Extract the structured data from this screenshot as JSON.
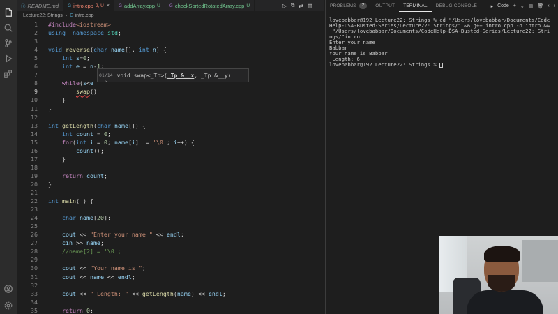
{
  "tabs": [
    {
      "icon": "ⓘ",
      "label": "README.md",
      "modifier": "",
      "style": "italic",
      "active": false
    },
    {
      "icon": "G",
      "label": "intro.cpp",
      "modifier": "2, U",
      "style": "active",
      "active": true
    },
    {
      "icon": "G",
      "label": "addArray.cpp",
      "modifier": "U",
      "style": "green",
      "active": false
    },
    {
      "icon": "G",
      "label": "checkSortedRotatedArray.cpp",
      "modifier": "U",
      "style": "green",
      "active": false
    }
  ],
  "breadcrumb": {
    "folder": "Lecture22: Strings",
    "file": "intro.cpp"
  },
  "hint": {
    "counter": "01/14",
    "pre": "void swap<_Tp>(",
    "param": "_Tp &__x",
    "post": ", _Tp &__y)"
  },
  "panel": {
    "tabs": [
      "PROBLEMS",
      "OUTPUT",
      "TERMINAL",
      "DEBUG CONSOLE"
    ],
    "problems_count": "2",
    "active_tab": "TERMINAL",
    "shell": "Code"
  },
  "terminal": [
    "lovebabbar@192 Lecture22: Strings % cd \"/Users/lovebabbar/Documents/Code",
    "Help-DSA-Busted-Series/Lecture22: Strings/\" && g++ intro.cpp -o intro &&",
    " \"/Users/lovebabbar/Documents/CodeHelp-DSA-Busted-Series/Lecture22: Stri",
    "ngs/\"intro",
    "Enter your name",
    "Babbar",
    "Your name is Babbar",
    " Length: 6",
    "lovebabbar@192 Lecture22: Strings % "
  ],
  "code": [
    {
      "n": "1",
      "t": [
        [
          "pp",
          "#include"
        ],
        [
          "inc",
          "<iostream>"
        ]
      ]
    },
    {
      "n": "2",
      "t": [
        [
          "kw",
          "using"
        ],
        [
          "",
          "  "
        ],
        [
          "kw",
          "namespace"
        ],
        [
          "",
          ""
        ],
        [
          "ns",
          " std"
        ],
        [
          "",
          ";"
        ]
      ]
    },
    {
      "n": "3",
      "t": []
    },
    {
      "n": "4",
      "t": [
        [
          "kw",
          "void"
        ],
        [
          "",
          " "
        ],
        [
          "fn",
          "reverse"
        ],
        [
          "",
          "("
        ],
        [
          "kw",
          "char"
        ],
        [
          "",
          " "
        ],
        [
          "var",
          "name"
        ],
        [
          "",
          "[], "
        ],
        [
          "kw",
          "int"
        ],
        [
          "",
          " "
        ],
        [
          "var",
          "n"
        ],
        [
          "",
          ") {"
        ]
      ]
    },
    {
      "n": "5",
      "t": [
        [
          "",
          "    "
        ],
        [
          "kw",
          "int"
        ],
        [
          "",
          " "
        ],
        [
          "var",
          "s"
        ],
        [
          "",
          "="
        ],
        [
          "num",
          "0"
        ],
        [
          "",
          ";"
        ]
      ]
    },
    {
      "n": "6",
      "t": [
        [
          "",
          "    "
        ],
        [
          "kw",
          "int"
        ],
        [
          "",
          " "
        ],
        [
          "var",
          "e"
        ],
        [
          "",
          " = "
        ],
        [
          "var",
          "n"
        ],
        [
          "",
          "-"
        ],
        [
          "num",
          "1"
        ],
        [
          "",
          ";"
        ]
      ]
    },
    {
      "n": "7",
      "t": []
    },
    {
      "n": "8",
      "t": [
        [
          "",
          "    "
        ],
        [
          "ctl",
          "while"
        ],
        [
          "",
          "("
        ],
        [
          "var",
          "s"
        ],
        [
          "",
          "<"
        ],
        [
          "var",
          "e"
        ],
        [
          "",
          ""
        ]
      ]
    },
    {
      "n": "9",
      "t": [
        [
          "",
          "        "
        ],
        [
          "fn squig",
          "swap"
        ],
        [
          "",
          "()"
        ]
      ]
    },
    {
      "n": "10",
      "t": [
        [
          "",
          "    }"
        ]
      ]
    },
    {
      "n": "11",
      "t": [
        [
          "",
          "}"
        ]
      ]
    },
    {
      "n": "12",
      "t": []
    },
    {
      "n": "13",
      "t": [
        [
          "kw",
          "int"
        ],
        [
          "",
          " "
        ],
        [
          "fn",
          "getLength"
        ],
        [
          "",
          "("
        ],
        [
          "kw",
          "char"
        ],
        [
          "",
          " "
        ],
        [
          "var",
          "name"
        ],
        [
          "",
          "[]) {"
        ]
      ]
    },
    {
      "n": "14",
      "t": [
        [
          "",
          "    "
        ],
        [
          "kw",
          "int"
        ],
        [
          "",
          " "
        ],
        [
          "var",
          "count"
        ],
        [
          "",
          " = "
        ],
        [
          "num",
          "0"
        ],
        [
          "",
          ";"
        ]
      ]
    },
    {
      "n": "15",
      "t": [
        [
          "",
          "    "
        ],
        [
          "ctl",
          "for"
        ],
        [
          "",
          "("
        ],
        [
          "kw",
          "int"
        ],
        [
          "",
          " "
        ],
        [
          "var",
          "i"
        ],
        [
          "",
          " = "
        ],
        [
          "num",
          "0"
        ],
        [
          "",
          "; "
        ],
        [
          "var",
          "name"
        ],
        [
          "",
          "["
        ],
        [
          "var",
          "i"
        ],
        [
          "",
          "] != "
        ],
        [
          "str",
          "'\\0'"
        ],
        [
          "",
          "; "
        ],
        [
          "var",
          "i"
        ],
        [
          "",
          "++) {"
        ]
      ]
    },
    {
      "n": "16",
      "t": [
        [
          "",
          "        "
        ],
        [
          "var",
          "count"
        ],
        [
          "",
          "++;"
        ]
      ]
    },
    {
      "n": "17",
      "t": [
        [
          "",
          "    }"
        ]
      ]
    },
    {
      "n": "18",
      "t": []
    },
    {
      "n": "19",
      "t": [
        [
          "",
          "    "
        ],
        [
          "ctl",
          "return"
        ],
        [
          "",
          " "
        ],
        [
          "var",
          "count"
        ],
        [
          "",
          ";"
        ]
      ]
    },
    {
      "n": "20",
      "t": [
        [
          "",
          "}"
        ]
      ]
    },
    {
      "n": "21",
      "t": []
    },
    {
      "n": "22",
      "t": [
        [
          "kw",
          "int"
        ],
        [
          "",
          " "
        ],
        [
          "fn",
          "main"
        ],
        [
          "",
          "( ) {"
        ]
      ]
    },
    {
      "n": "23",
      "t": []
    },
    {
      "n": "24",
      "t": [
        [
          "",
          "    "
        ],
        [
          "kw",
          "char"
        ],
        [
          "",
          " "
        ],
        [
          "var",
          "name"
        ],
        [
          "",
          "["
        ],
        [
          "num",
          "20"
        ],
        [
          "",
          "];"
        ]
      ]
    },
    {
      "n": "25",
      "t": []
    },
    {
      "n": "26",
      "t": [
        [
          "",
          "    "
        ],
        [
          "var",
          "cout"
        ],
        [
          "",
          " << "
        ],
        [
          "str",
          "\"Enter your name \""
        ],
        [
          "",
          " << "
        ],
        [
          "var",
          "endl"
        ],
        [
          "",
          ";"
        ]
      ]
    },
    {
      "n": "27",
      "t": [
        [
          "",
          "    "
        ],
        [
          "var",
          "cin"
        ],
        [
          "",
          " >> "
        ],
        [
          "var",
          "name"
        ],
        [
          "",
          ";"
        ]
      ]
    },
    {
      "n": "28",
      "t": [
        [
          "",
          "    "
        ],
        [
          "cmt",
          "//name[2] = '\\0';"
        ]
      ]
    },
    {
      "n": "29",
      "t": []
    },
    {
      "n": "30",
      "t": [
        [
          "",
          "    "
        ],
        [
          "var",
          "cout"
        ],
        [
          "",
          " << "
        ],
        [
          "str",
          "\"Your name is \""
        ],
        [
          "",
          ";"
        ]
      ]
    },
    {
      "n": "31",
      "t": [
        [
          "",
          "    "
        ],
        [
          "var",
          "cout"
        ],
        [
          "",
          " << "
        ],
        [
          "var",
          "name"
        ],
        [
          "",
          " << "
        ],
        [
          "var",
          "endl"
        ],
        [
          "",
          ";"
        ]
      ]
    },
    {
      "n": "32",
      "t": []
    },
    {
      "n": "33",
      "t": [
        [
          "",
          "    "
        ],
        [
          "var",
          "cout"
        ],
        [
          "",
          " << "
        ],
        [
          "str",
          "\" Length: \""
        ],
        [
          "",
          " << "
        ],
        [
          "fn",
          "getLength"
        ],
        [
          "",
          "("
        ],
        [
          "var",
          "name"
        ],
        [
          "",
          ") << "
        ],
        [
          "var",
          "endl"
        ],
        [
          "",
          ";"
        ]
      ]
    },
    {
      "n": "34",
      "t": []
    },
    {
      "n": "35",
      "t": [
        [
          "",
          "    "
        ],
        [
          "ctl",
          "return"
        ],
        [
          "",
          " "
        ],
        [
          "num",
          "0"
        ],
        [
          "",
          ";"
        ]
      ]
    }
  ],
  "current_line": "9"
}
